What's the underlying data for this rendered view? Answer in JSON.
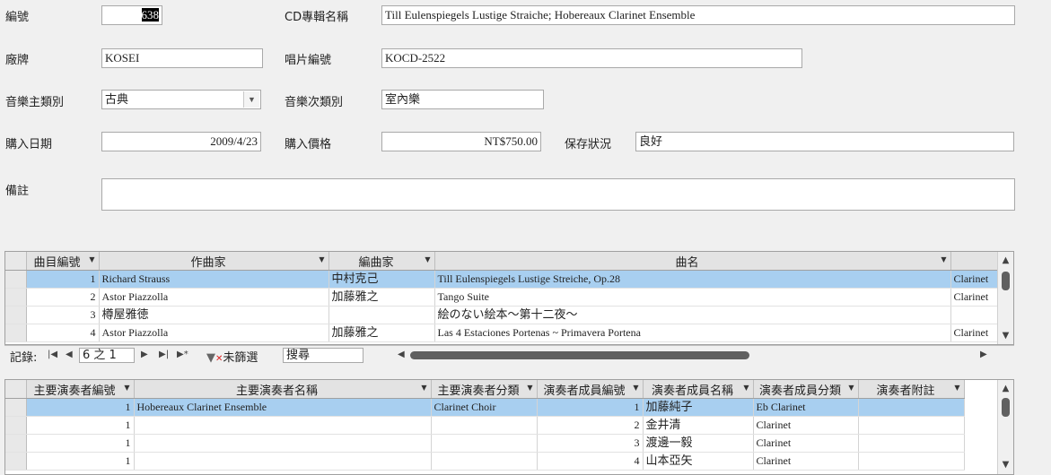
{
  "form": {
    "id_label": "編號",
    "id_value": "638",
    "album_label": "CD專輯名稱",
    "album_value": "Till Eulenspiegels Lustige Straiche; Hobereaux Clarinet Ensemble",
    "label_label": "廠牌",
    "label_value": "KOSEI",
    "catno_label": "唱片編號",
    "catno_value": "KOCD-2522",
    "main_genre_label": "音樂主類別",
    "main_genre_value": "古典",
    "sub_genre_label": "音樂次類別",
    "sub_genre_value": "室內樂",
    "date_label": "購入日期",
    "date_value": "2009/4/23",
    "price_label": "購入價格",
    "price_value": "NT$750.00",
    "condition_label": "保存狀況",
    "condition_value": "良好",
    "notes_label": "備註",
    "notes_value": ""
  },
  "tracks": {
    "headers": [
      "曲目編號",
      "作曲家",
      "編曲家",
      "曲名",
      ""
    ],
    "rows": [
      {
        "no": "1",
        "composer": "Richard Strauss",
        "arranger": "中村克己",
        "title": "Till Eulenspiegels Lustige Streiche, Op.28",
        "extra": "Clarinet"
      },
      {
        "no": "2",
        "composer": "Astor Piazzolla",
        "arranger": "加藤雅之",
        "title": "Tango Suite",
        "extra": "Clarinet"
      },
      {
        "no": "3",
        "composer": "樽屋雅徳",
        "arranger": "",
        "title": "絵のない絵本～第十二夜～",
        "extra": ""
      },
      {
        "no": "4",
        "composer": "Astor Piazzolla",
        "arranger": "加藤雅之",
        "title": "Las 4 Estaciones Portenas ~ Primavera Portena",
        "extra": "Clarinet"
      }
    ]
  },
  "nav": {
    "record_label": "記錄:",
    "position": "6 之 1",
    "filter_label": "未篩選",
    "search_label": "搜尋"
  },
  "performers": {
    "headers": [
      "主要演奏者編號",
      "主要演奏者名稱",
      "主要演奏者分類",
      "演奏者成員編號",
      "演奏者成員名稱",
      "演奏者成員分類",
      "演奏者附註"
    ],
    "rows": [
      {
        "main_no": "1",
        "main_name": "Hobereaux Clarinet Ensemble",
        "main_cat": "Clarinet Choir",
        "member_no": "1",
        "member_name": "加藤純子",
        "member_cat": "Eb Clarinet",
        "note": ""
      },
      {
        "main_no": "1",
        "main_name": "",
        "main_cat": "",
        "member_no": "2",
        "member_name": "金井清",
        "member_cat": "Clarinet",
        "note": ""
      },
      {
        "main_no": "1",
        "main_name": "",
        "main_cat": "",
        "member_no": "3",
        "member_name": "渡邊一毅",
        "member_cat": "Clarinet",
        "note": ""
      },
      {
        "main_no": "1",
        "main_name": "",
        "main_cat": "",
        "member_no": "4",
        "member_name": "山本亞矢",
        "member_cat": "Clarinet",
        "note": ""
      }
    ]
  },
  "colors": {
    "selected_row": "#a8cff0",
    "background": "#f0f0f0"
  }
}
